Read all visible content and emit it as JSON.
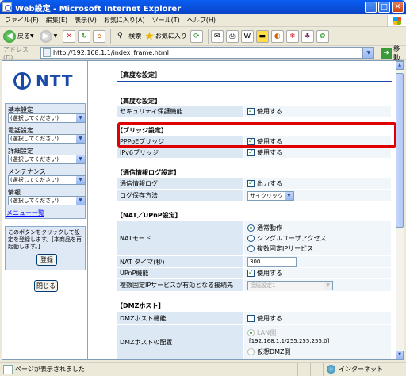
{
  "window": {
    "title": "Web設定 - Microsoft Internet Explorer"
  },
  "menu": {
    "items": [
      "ファイル(F)",
      "編集(E)",
      "表示(V)",
      "お気に入り(A)",
      "ツール(T)",
      "ヘルプ(H)"
    ]
  },
  "toolbar": {
    "back_label": "戻る",
    "search_label": "検索",
    "favorites_label": "お気に入り"
  },
  "address": {
    "label": "アドレス(D)",
    "url": "http://192.168.1.1/index_frame.html",
    "go_label": "移動"
  },
  "sidebar": {
    "logo_text": "NTT",
    "groups": [
      {
        "label": "基本設定",
        "select": "(選択してください)"
      },
      {
        "label": "電話設定",
        "select": "(選択してください)"
      },
      {
        "label": "詳細設定",
        "select": "(選択してください)"
      },
      {
        "label": "メンテナンス",
        "select": "(選択してください)"
      },
      {
        "label": "情報",
        "select": "(選択してください)"
      }
    ],
    "menu_list_link": "メニュー一覧",
    "info_text": "このボタンをクリックして設定を登録します。[本商品を再起動します。]",
    "register_button": "登録",
    "close_button": "閉じる"
  },
  "main": {
    "page_title": "［高度な設定］",
    "sections": {
      "advanced": {
        "title": "【高度な設定】",
        "security_label": "セキュリティ保護機能",
        "security_value": "使用する"
      },
      "bridge": {
        "title": "【ブリッジ設定】",
        "pppoe_label": "PPPoEブリッジ",
        "pppoe_value": "使用する",
        "ipv6_label": "IPv6ブリッジ",
        "ipv6_value": "使用する"
      },
      "log": {
        "title": "【通信情報ログ設定】",
        "log_label": "通信情報ログ",
        "log_value": "出力する",
        "save_label": "ログ保存方法",
        "save_value": "サイクリック"
      },
      "nat": {
        "title": "【NAT／UPnP設定】",
        "mode_label": "NATモード",
        "mode_options": [
          "通常動作",
          "シングルユーザアクセス",
          "複数固定IPサービス"
        ],
        "timer_label": "NAT タイマ(秒)",
        "timer_value": "300",
        "upnp_label": "UPnP機能",
        "upnp_value": "使用する",
        "multi_label": "複数固定IPサービスが有効となる接続先",
        "multi_value": "接続設定1"
      },
      "dmz": {
        "title": "【DMZホスト】",
        "dmz_label": "DMZホスト機能",
        "dmz_value": "使用する",
        "placement_label": "DMZホストの配置",
        "lan_option": "LAN側",
        "lan_address": "[192.168.1.1/255.255.255.0]",
        "virtual_option": "仮想DMZ側"
      }
    }
  },
  "status": {
    "message": "ページが表示されました",
    "zone": "インターネット"
  }
}
